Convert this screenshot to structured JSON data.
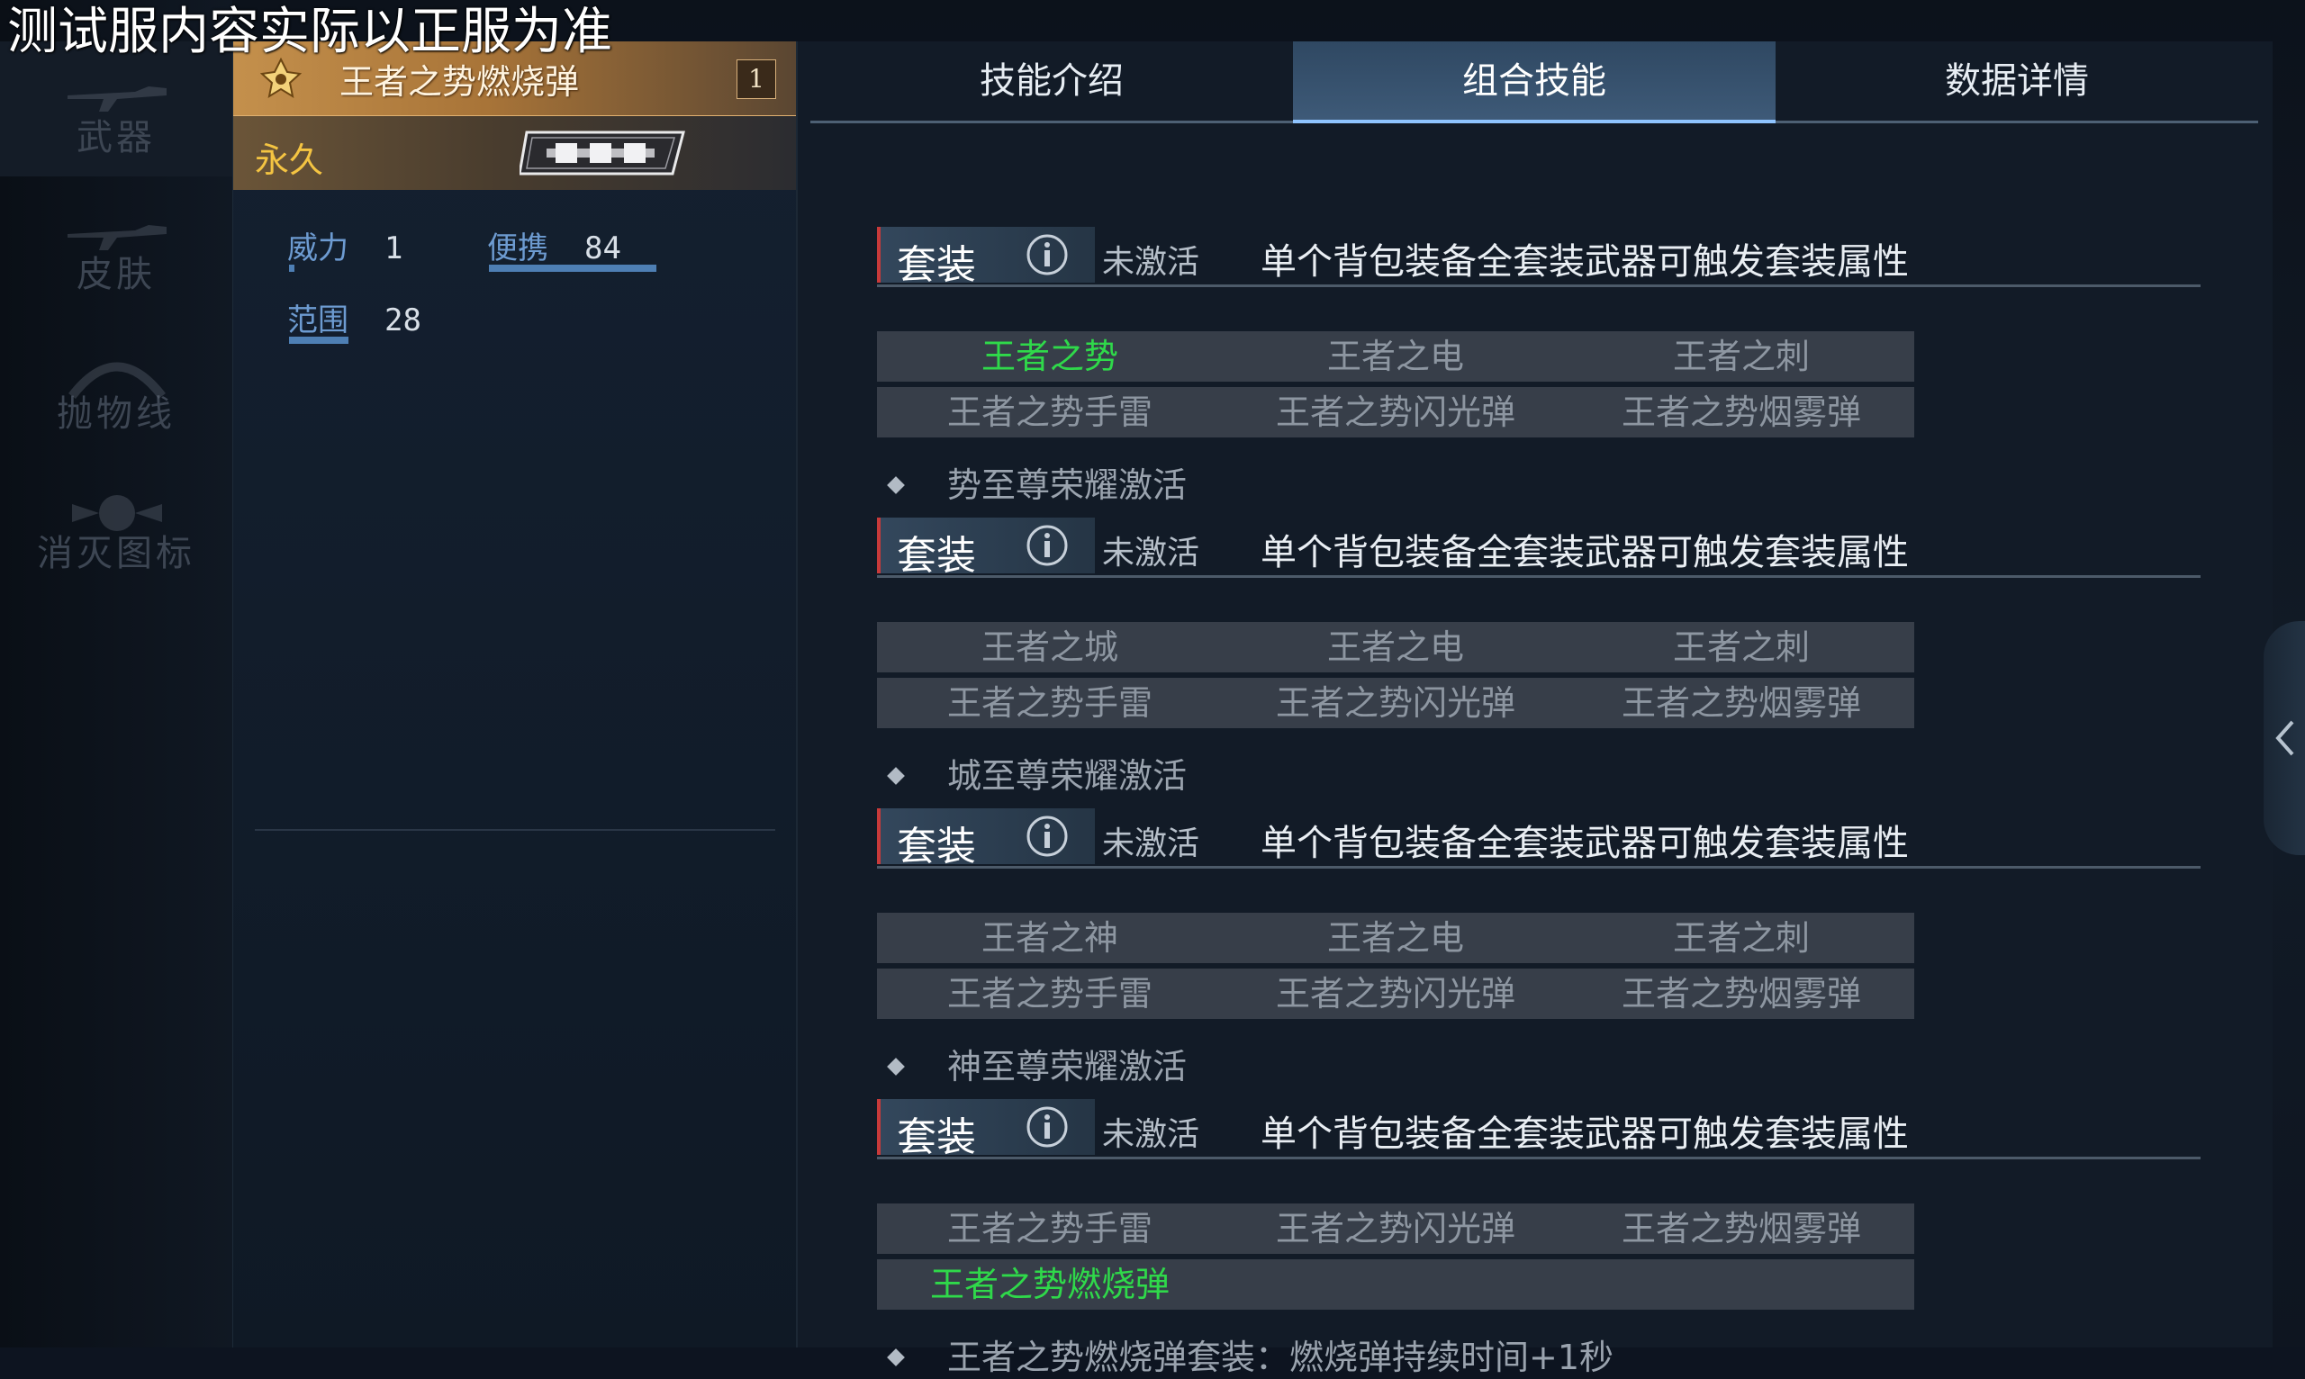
{
  "watermark": "测试服内容实际以正服为准",
  "nav": {
    "items": [
      {
        "label": "武器"
      },
      {
        "label": "皮肤"
      },
      {
        "label": "抛物线"
      },
      {
        "label": "消灭图标"
      }
    ]
  },
  "item": {
    "name": "王者之势燃烧弹",
    "count": "1",
    "duration": "永久",
    "stats": {
      "power_label": "威力",
      "power_value": "1",
      "portable_label": "便携",
      "portable_value": "84",
      "range_label": "范围",
      "range_value": "28"
    }
  },
  "tabs": [
    {
      "label": "技能介绍"
    },
    {
      "label": "组合技能"
    },
    {
      "label": "数据详情"
    }
  ],
  "sets": [
    {
      "tag": "套装",
      "status": "未激活",
      "desc": "单个背包装备全套装武器可触发套装属性",
      "row1": [
        "王者之势",
        "王者之电",
        "王者之刺"
      ],
      "row2": [
        "王者之势手雷",
        "王者之势闪光弹",
        "王者之势烟雾弹"
      ],
      "effect": "势至尊荣耀激活"
    },
    {
      "tag": "套装",
      "status": "未激活",
      "desc": "单个背包装备全套装武器可触发套装属性",
      "row1": [
        "王者之城",
        "王者之电",
        "王者之刺"
      ],
      "row2": [
        "王者之势手雷",
        "王者之势闪光弹",
        "王者之势烟雾弹"
      ],
      "effect": "城至尊荣耀激活"
    },
    {
      "tag": "套装",
      "status": "未激活",
      "desc": "单个背包装备全套装武器可触发套装属性",
      "row1": [
        "王者之神",
        "王者之电",
        "王者之刺"
      ],
      "row2": [
        "王者之势手雷",
        "王者之势闪光弹",
        "王者之势烟雾弹"
      ],
      "effect": "神至尊荣耀激活"
    },
    {
      "tag": "套装",
      "status": "未激活",
      "desc": "单个背包装备全套装武器可触发套装属性",
      "row1": [
        "王者之势手雷",
        "王者之势闪光弹",
        "王者之势烟雾弹"
      ],
      "row2": [
        "王者之势燃烧弹"
      ],
      "effect": "王者之势燃烧弹套装：燃烧弹持续时间+1秒"
    }
  ],
  "colors": {
    "active_green": "#2fd94a",
    "gold": "#f4c442",
    "stat_blue": "#6d9bd1",
    "tab_active": "#3e5a78"
  },
  "icons": {
    "item_badge": "crown-badge-icon",
    "info": "info-icon",
    "collapse": "chevron-left-icon"
  }
}
